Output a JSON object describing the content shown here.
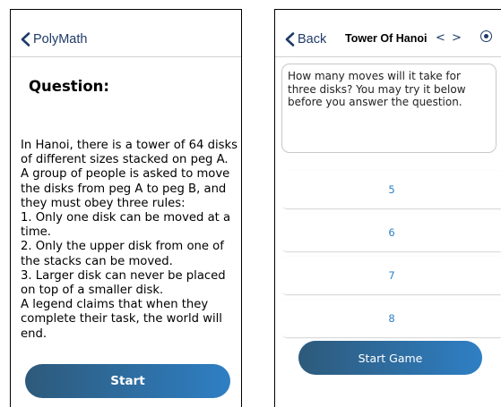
{
  "left": {
    "back_label": "PolyMath",
    "question_heading": "Question:",
    "question_text": "In Hanoi, there is a tower of 64 disks of different sizes stacked on peg A. A group of people is asked to move the disks from peg A to peg B, and they must obey three rules:\n1. Only one disk can be moved at a time.\n2. Only the upper disk from one of the stacks can be moved.\n3. Larger disk can never be placed on top of a smaller disk.\nA legend claims that when they complete their task, the world will end.",
    "start_label": "Start"
  },
  "right": {
    "back_label": "Back",
    "title": "Tower Of Hanoi",
    "prev_arrow": "<",
    "next_arrow": ">",
    "question_text": "How many moves will it take for three disks? You may try it below before you answer the question.",
    "answers": [
      "5",
      "6",
      "7",
      "8"
    ],
    "start_game_label": "Start Game"
  },
  "colors": {
    "accent": "#1f3a68",
    "button_gradient_start": "#2d5a7b",
    "button_gradient_end": "#2f7fc4",
    "answer_text": "#2f7fc4"
  },
  "icons": {
    "back": "chevron-left-icon",
    "mode": "radio-button-icon"
  }
}
